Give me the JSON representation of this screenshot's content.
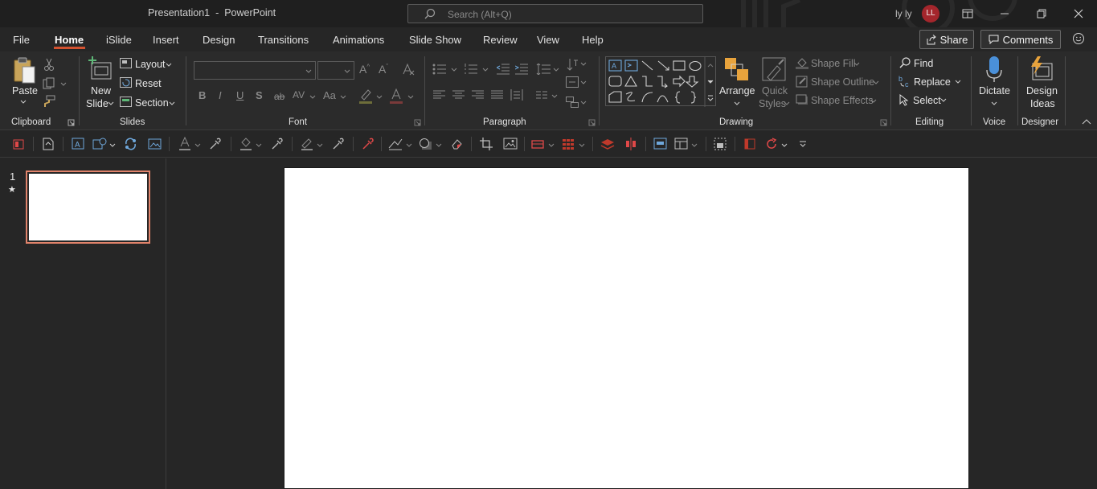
{
  "titlebar": {
    "title": "Presentation1  -  PowerPoint",
    "search_placeholder": "Search (Alt+Q)",
    "user_name": "ly ly",
    "avatar_initials": "LL",
    "avatar_color": "#a4262c"
  },
  "tabs": [
    {
      "label": "File"
    },
    {
      "label": "Home",
      "active": true
    },
    {
      "label": "iSlide"
    },
    {
      "label": "Insert"
    },
    {
      "label": "Design"
    },
    {
      "label": "Transitions"
    },
    {
      "label": "Animations"
    },
    {
      "label": "Slide Show"
    },
    {
      "label": "Review"
    },
    {
      "label": "View"
    },
    {
      "label": "Help"
    }
  ],
  "share_label": "Share",
  "comments_label": "Comments",
  "accent_color": "#d35230",
  "ribbon": {
    "clipboard": {
      "label": "Clipboard",
      "paste": "Paste"
    },
    "slides": {
      "label": "Slides",
      "new_slide_1": "New",
      "new_slide_2": "Slide",
      "layout": "Layout",
      "reset": "Reset",
      "section": "Section"
    },
    "font": {
      "label": "Font",
      "font_name": "",
      "font_size": ""
    },
    "paragraph": {
      "label": "Paragraph"
    },
    "drawing": {
      "label": "Drawing",
      "arrange": "Arrange",
      "quick_styles_1": "Quick",
      "quick_styles_2": "Styles",
      "shape_fill": "Shape Fill",
      "shape_outline": "Shape Outline",
      "shape_effects": "Shape Effects"
    },
    "editing": {
      "label": "Editing",
      "find": "Find",
      "replace": "Replace",
      "select": "Select"
    },
    "voice": {
      "label": "Voice",
      "dictate": "Dictate"
    },
    "designer": {
      "label": "Designer",
      "design_ideas_1": "Design",
      "design_ideas_2": "Ideas"
    }
  },
  "thumbnails": {
    "slide_number": "1",
    "star": "★"
  }
}
